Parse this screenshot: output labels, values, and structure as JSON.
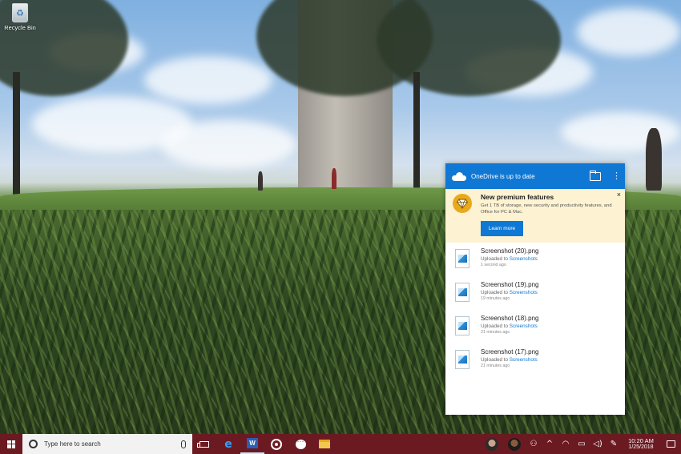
{
  "desktop": {
    "recycle_bin_label": "Recycle Bin"
  },
  "onedrive": {
    "header_title": "OneDrive is up to date",
    "icons": {
      "cloud": "cloud-icon",
      "folder": "folder-icon",
      "more": "more-icon"
    },
    "more_glyph": "⋮",
    "promo": {
      "title": "New premium features",
      "description": "Get 1 TB of storage, new security and productivity features, and Office for PC & Mac.",
      "button_label": "Learn more",
      "close_glyph": "×"
    },
    "files": [
      {
        "name": "Screenshot (20).png",
        "uploaded_prefix": "Uploaded to ",
        "folder": "Screenshots",
        "time": "1 second ago"
      },
      {
        "name": "Screenshot (19).png",
        "uploaded_prefix": "Uploaded to ",
        "folder": "Screenshots",
        "time": "19 minutes ago"
      },
      {
        "name": "Screenshot (18).png",
        "uploaded_prefix": "Uploaded to ",
        "folder": "Screenshots",
        "time": "21 minutes ago"
      },
      {
        "name": "Screenshot (17).png",
        "uploaded_prefix": "Uploaded to ",
        "folder": "Screenshots",
        "time": "21 minutes ago"
      }
    ],
    "colors": {
      "accent": "#0f78d4",
      "promo_bg": "#fdf3d3",
      "badge": "#e9a91c"
    }
  },
  "taskbar": {
    "search_placeholder": "Type here to search",
    "tray": {
      "people_glyph": "⚇",
      "chevron_glyph": "^",
      "network_glyph": "◠",
      "battery_glyph": "▭",
      "volume_glyph": "◁)",
      "pen_glyph": "✎"
    },
    "clock": {
      "time": "10:20 AM",
      "date": "1/25/2018"
    },
    "color": "#6b1a21"
  }
}
